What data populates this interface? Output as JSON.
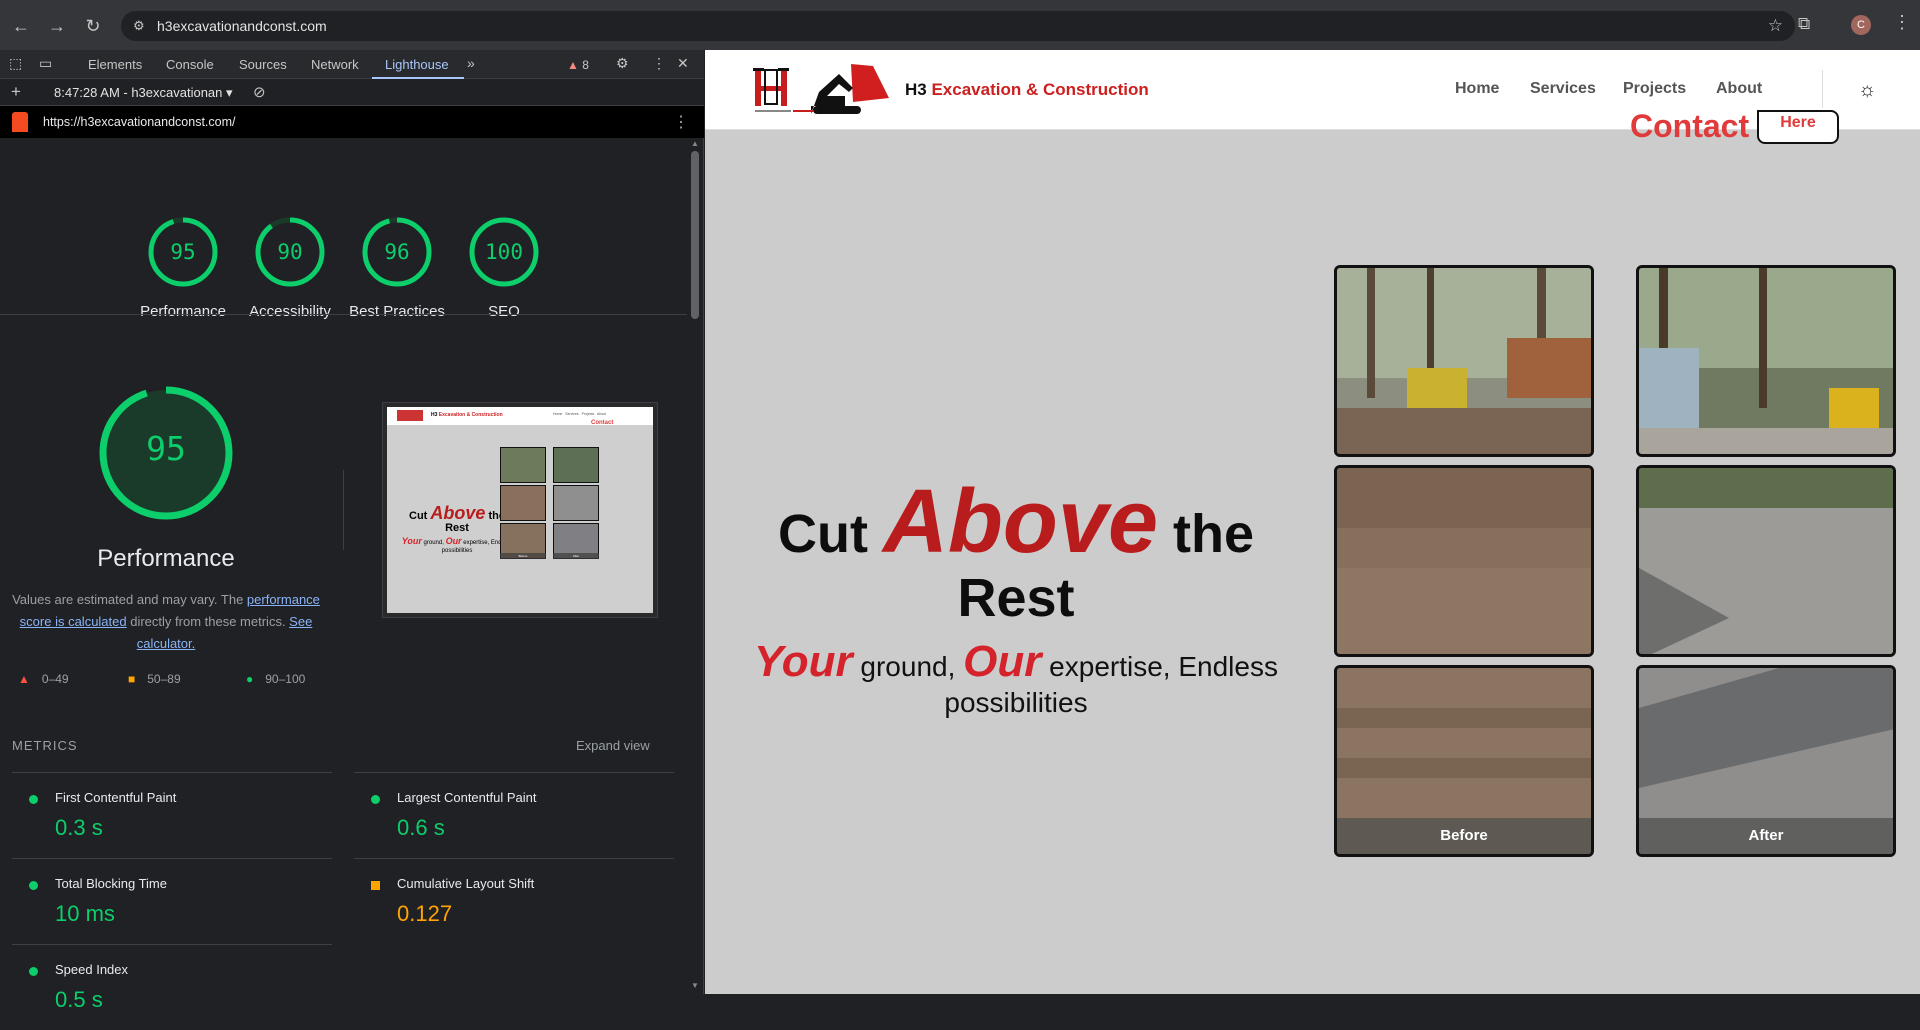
{
  "browser": {
    "url": "h3excavationandconst.com",
    "profile_initial": "C"
  },
  "devtools": {
    "tabs": [
      "Elements",
      "Console",
      "Sources",
      "Network",
      "Lighthouse"
    ],
    "warnings": "8",
    "report_select": "8:47:28 AM - h3excavationan",
    "report_url": "https://h3excavationandconst.com/",
    "scores": [
      {
        "name": "Performance",
        "value": "95"
      },
      {
        "name": "Accessibility",
        "value": "90"
      },
      {
        "name": "Best Practices",
        "value": "96"
      },
      {
        "name": "SEO",
        "value": "100"
      }
    ],
    "score_fractions": [
      0.95,
      0.9,
      0.96,
      1.0
    ],
    "perf": {
      "score": "95",
      "title": "Performance",
      "note_prefix": "Values are estimated and may vary. The ",
      "note_link": "performance score is calculated",
      "note_mid": " directly from these metrics. ",
      "note_link2": "See calculator."
    },
    "legend": [
      "0–49",
      "50–89",
      "90–100"
    ],
    "metrics_heading": "METRICS",
    "expand_label": "Expand view",
    "metrics": [
      {
        "name": "First Contentful Paint",
        "value": "0.3 s",
        "status": "good"
      },
      {
        "name": "Largest Contentful Paint",
        "value": "0.6 s",
        "status": "good"
      },
      {
        "name": "Total Blocking Time",
        "value": "10 ms",
        "status": "good"
      },
      {
        "name": "Cumulative Layout Shift",
        "value": "0.127",
        "status": "average"
      },
      {
        "name": "Speed Index",
        "value": "0.5 s",
        "status": "good"
      }
    ],
    "thumb": {
      "brand_a": "H3 ",
      "brand_b": "Excavation & Construction",
      "nav": [
        "Home",
        "Services",
        "Projects",
        "About"
      ],
      "contact": "Contact",
      "t1": "Cut ",
      "t2": "Above",
      "t3": " the",
      "t4": "Rest",
      "s1": "Your",
      "s2": " ground, ",
      "s3": "Our",
      "s4": " expertise, Endless possibilities",
      "before": "Before",
      "after": "After"
    }
  },
  "site": {
    "brand_prefix": "H3 ",
    "brand_name": "Excavation & Construction",
    "nav": [
      "Home",
      "Services",
      "Projects",
      "About"
    ],
    "contact": "Contact",
    "here": "Here",
    "hero": {
      "cut": "Cut ",
      "above": "Above",
      "the": " the",
      "rest": "Rest",
      "your": "Your",
      "ground": " ground, ",
      "our": "Our",
      "expertise": " expertise, Endless possibilities"
    },
    "before_label": "Before",
    "after_label": "After"
  },
  "colors": {
    "good": "#0cce6b",
    "average": "#ffa400",
    "fail": "#ff4e42",
    "brand_red": "#cc1f1f"
  }
}
